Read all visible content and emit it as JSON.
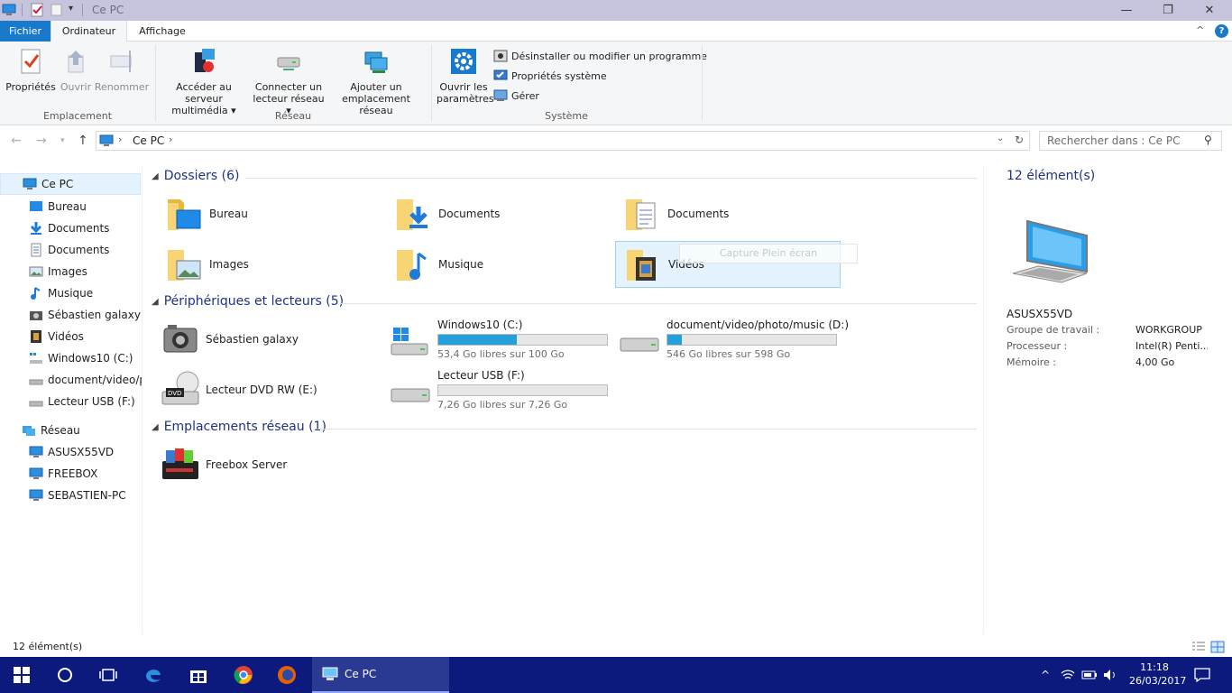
{
  "window": {
    "title": "Ce PC",
    "minimize": "—",
    "maximize": "❐",
    "close": "✕"
  },
  "ribbon": {
    "tabs": [
      "Fichier",
      "Ordinateur",
      "Affichage"
    ],
    "collapse": "^",
    "help": "?",
    "groups": {
      "emplacement": {
        "label": "Emplacement",
        "buttons": [
          "Propriétés",
          "Ouvrir",
          "Renommer"
        ]
      },
      "reseau": {
        "label": "Réseau",
        "buttons": [
          {
            "line1": "Accéder au serveur",
            "line2": "multimédia ▾"
          },
          {
            "line1": "Connecter un",
            "line2": "lecteur réseau ▾"
          },
          {
            "line1": "Ajouter un",
            "line2": "emplacement réseau"
          }
        ]
      },
      "systeme": {
        "label": "Système",
        "open_settings": {
          "line1": "Ouvrir les",
          "line2": "paramètres"
        },
        "small": [
          "Désinstaller ou modifier un programme",
          "Propriétés système",
          "Gérer"
        ]
      }
    }
  },
  "address": {
    "path": "Ce PC",
    "search_placeholder": "Rechercher dans : Ce PC"
  },
  "sidebar": {
    "root": "Ce PC",
    "items": [
      "Bureau",
      "Documents",
      "Documents",
      "Images",
      "Musique",
      "Sébastien galaxy",
      "Vidéos",
      "Windows10 (C:)",
      "document/video/pl",
      "Lecteur USB (F:)"
    ],
    "network": "Réseau",
    "network_items": [
      "ASUSX55VD",
      "FREEBOX",
      "SEBASTIEN-PC"
    ]
  },
  "content": {
    "folders_header": "Dossiers (6)",
    "folders": [
      "Bureau",
      "Documents",
      "Documents",
      "Images",
      "Musique",
      "Vidéos"
    ],
    "devices_header": "Périphériques et lecteurs (5)",
    "devices": {
      "camera": "Sébastien galaxy",
      "dvd": "Lecteur DVD RW (E:)",
      "c": {
        "name": "Windows10 (C:)",
        "free": "53,4 Go libres sur 100 Go",
        "used_fraction": 0.466
      },
      "d": {
        "name": "document/video/photo/music (D:)",
        "free": "546 Go libres sur 598 Go",
        "used_fraction": 0.087
      },
      "f": {
        "name": "Lecteur USB (F:)",
        "free": "7,26 Go libres sur 7,26 Go",
        "used_fraction": 0.0
      }
    },
    "network_header": "Emplacements réseau (1)",
    "network": [
      "Freebox Server"
    ],
    "ghost_tooltip": "Capture Plein écran"
  },
  "details": {
    "count": "12 élément(s)",
    "pc_name": "ASUSX55VD",
    "rows": [
      {
        "label": "Groupe de travail :",
        "value": "WORKGROUP"
      },
      {
        "label": "Processeur :",
        "value": "Intel(R) Penti..."
      },
      {
        "label": "Mémoire :",
        "value": "4,00 Go"
      }
    ]
  },
  "status": {
    "count": "12 élément(s)"
  },
  "taskbar": {
    "active_app": "Ce PC",
    "time": "11:18",
    "date": "26/03/2017"
  },
  "colors": {
    "accent": "#1979ca",
    "taskbar": "#0b1a7c",
    "header_text": "#1e3287",
    "drive_bar": "#26a0da",
    "folder": "#f0c350"
  }
}
